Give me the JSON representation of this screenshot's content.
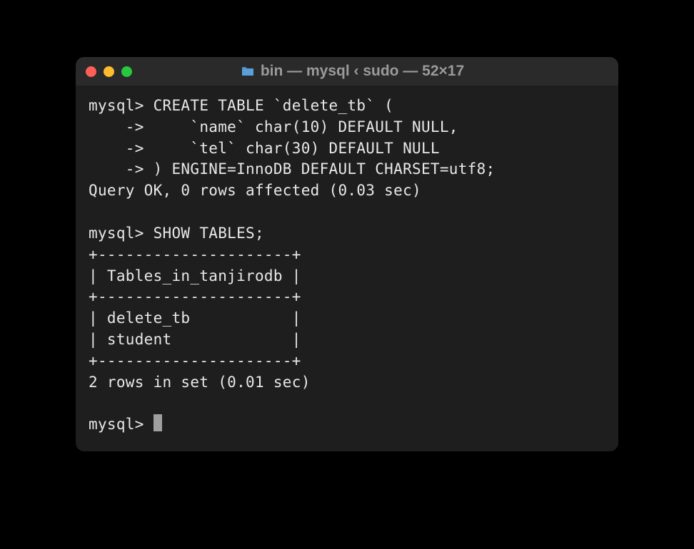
{
  "titlebar": {
    "title": "bin — mysql ‹ sudo — 52×17"
  },
  "terminal": {
    "lines": [
      "mysql> CREATE TABLE `delete_tb` (",
      "    ->     `name` char(10) DEFAULT NULL,",
      "    ->     `tel` char(30) DEFAULT NULL",
      "    -> ) ENGINE=InnoDB DEFAULT CHARSET=utf8;",
      "Query OK, 0 rows affected (0.03 sec)",
      "",
      "mysql> SHOW TABLES;",
      "+---------------------+",
      "| Tables_in_tanjirodb |",
      "+---------------------+",
      "| delete_tb           |",
      "| student             |",
      "+---------------------+",
      "2 rows in set (0.01 sec)",
      "",
      "mysql> "
    ]
  }
}
